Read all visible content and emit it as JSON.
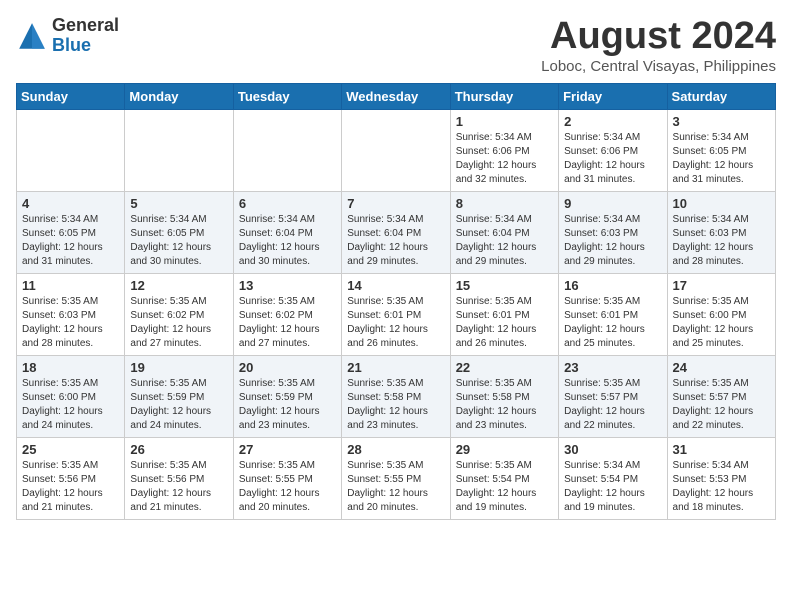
{
  "logo": {
    "general": "General",
    "blue": "Blue"
  },
  "title": "August 2024",
  "subtitle": "Loboc, Central Visayas, Philippines",
  "days": [
    "Sunday",
    "Monday",
    "Tuesday",
    "Wednesday",
    "Thursday",
    "Friday",
    "Saturday"
  ],
  "weeks": [
    [
      {
        "day": "",
        "info": ""
      },
      {
        "day": "",
        "info": ""
      },
      {
        "day": "",
        "info": ""
      },
      {
        "day": "",
        "info": ""
      },
      {
        "day": "1",
        "info": "Sunrise: 5:34 AM\nSunset: 6:06 PM\nDaylight: 12 hours\nand 32 minutes."
      },
      {
        "day": "2",
        "info": "Sunrise: 5:34 AM\nSunset: 6:06 PM\nDaylight: 12 hours\nand 31 minutes."
      },
      {
        "day": "3",
        "info": "Sunrise: 5:34 AM\nSunset: 6:05 PM\nDaylight: 12 hours\nand 31 minutes."
      }
    ],
    [
      {
        "day": "4",
        "info": "Sunrise: 5:34 AM\nSunset: 6:05 PM\nDaylight: 12 hours\nand 31 minutes."
      },
      {
        "day": "5",
        "info": "Sunrise: 5:34 AM\nSunset: 6:05 PM\nDaylight: 12 hours\nand 30 minutes."
      },
      {
        "day": "6",
        "info": "Sunrise: 5:34 AM\nSunset: 6:04 PM\nDaylight: 12 hours\nand 30 minutes."
      },
      {
        "day": "7",
        "info": "Sunrise: 5:34 AM\nSunset: 6:04 PM\nDaylight: 12 hours\nand 29 minutes."
      },
      {
        "day": "8",
        "info": "Sunrise: 5:34 AM\nSunset: 6:04 PM\nDaylight: 12 hours\nand 29 minutes."
      },
      {
        "day": "9",
        "info": "Sunrise: 5:34 AM\nSunset: 6:03 PM\nDaylight: 12 hours\nand 29 minutes."
      },
      {
        "day": "10",
        "info": "Sunrise: 5:34 AM\nSunset: 6:03 PM\nDaylight: 12 hours\nand 28 minutes."
      }
    ],
    [
      {
        "day": "11",
        "info": "Sunrise: 5:35 AM\nSunset: 6:03 PM\nDaylight: 12 hours\nand 28 minutes."
      },
      {
        "day": "12",
        "info": "Sunrise: 5:35 AM\nSunset: 6:02 PM\nDaylight: 12 hours\nand 27 minutes."
      },
      {
        "day": "13",
        "info": "Sunrise: 5:35 AM\nSunset: 6:02 PM\nDaylight: 12 hours\nand 27 minutes."
      },
      {
        "day": "14",
        "info": "Sunrise: 5:35 AM\nSunset: 6:01 PM\nDaylight: 12 hours\nand 26 minutes."
      },
      {
        "day": "15",
        "info": "Sunrise: 5:35 AM\nSunset: 6:01 PM\nDaylight: 12 hours\nand 26 minutes."
      },
      {
        "day": "16",
        "info": "Sunrise: 5:35 AM\nSunset: 6:01 PM\nDaylight: 12 hours\nand 25 minutes."
      },
      {
        "day": "17",
        "info": "Sunrise: 5:35 AM\nSunset: 6:00 PM\nDaylight: 12 hours\nand 25 minutes."
      }
    ],
    [
      {
        "day": "18",
        "info": "Sunrise: 5:35 AM\nSunset: 6:00 PM\nDaylight: 12 hours\nand 24 minutes."
      },
      {
        "day": "19",
        "info": "Sunrise: 5:35 AM\nSunset: 5:59 PM\nDaylight: 12 hours\nand 24 minutes."
      },
      {
        "day": "20",
        "info": "Sunrise: 5:35 AM\nSunset: 5:59 PM\nDaylight: 12 hours\nand 23 minutes."
      },
      {
        "day": "21",
        "info": "Sunrise: 5:35 AM\nSunset: 5:58 PM\nDaylight: 12 hours\nand 23 minutes."
      },
      {
        "day": "22",
        "info": "Sunrise: 5:35 AM\nSunset: 5:58 PM\nDaylight: 12 hours\nand 23 minutes."
      },
      {
        "day": "23",
        "info": "Sunrise: 5:35 AM\nSunset: 5:57 PM\nDaylight: 12 hours\nand 22 minutes."
      },
      {
        "day": "24",
        "info": "Sunrise: 5:35 AM\nSunset: 5:57 PM\nDaylight: 12 hours\nand 22 minutes."
      }
    ],
    [
      {
        "day": "25",
        "info": "Sunrise: 5:35 AM\nSunset: 5:56 PM\nDaylight: 12 hours\nand 21 minutes."
      },
      {
        "day": "26",
        "info": "Sunrise: 5:35 AM\nSunset: 5:56 PM\nDaylight: 12 hours\nand 21 minutes."
      },
      {
        "day": "27",
        "info": "Sunrise: 5:35 AM\nSunset: 5:55 PM\nDaylight: 12 hours\nand 20 minutes."
      },
      {
        "day": "28",
        "info": "Sunrise: 5:35 AM\nSunset: 5:55 PM\nDaylight: 12 hours\nand 20 minutes."
      },
      {
        "day": "29",
        "info": "Sunrise: 5:35 AM\nSunset: 5:54 PM\nDaylight: 12 hours\nand 19 minutes."
      },
      {
        "day": "30",
        "info": "Sunrise: 5:34 AM\nSunset: 5:54 PM\nDaylight: 12 hours\nand 19 minutes."
      },
      {
        "day": "31",
        "info": "Sunrise: 5:34 AM\nSunset: 5:53 PM\nDaylight: 12 hours\nand 18 minutes."
      }
    ]
  ]
}
